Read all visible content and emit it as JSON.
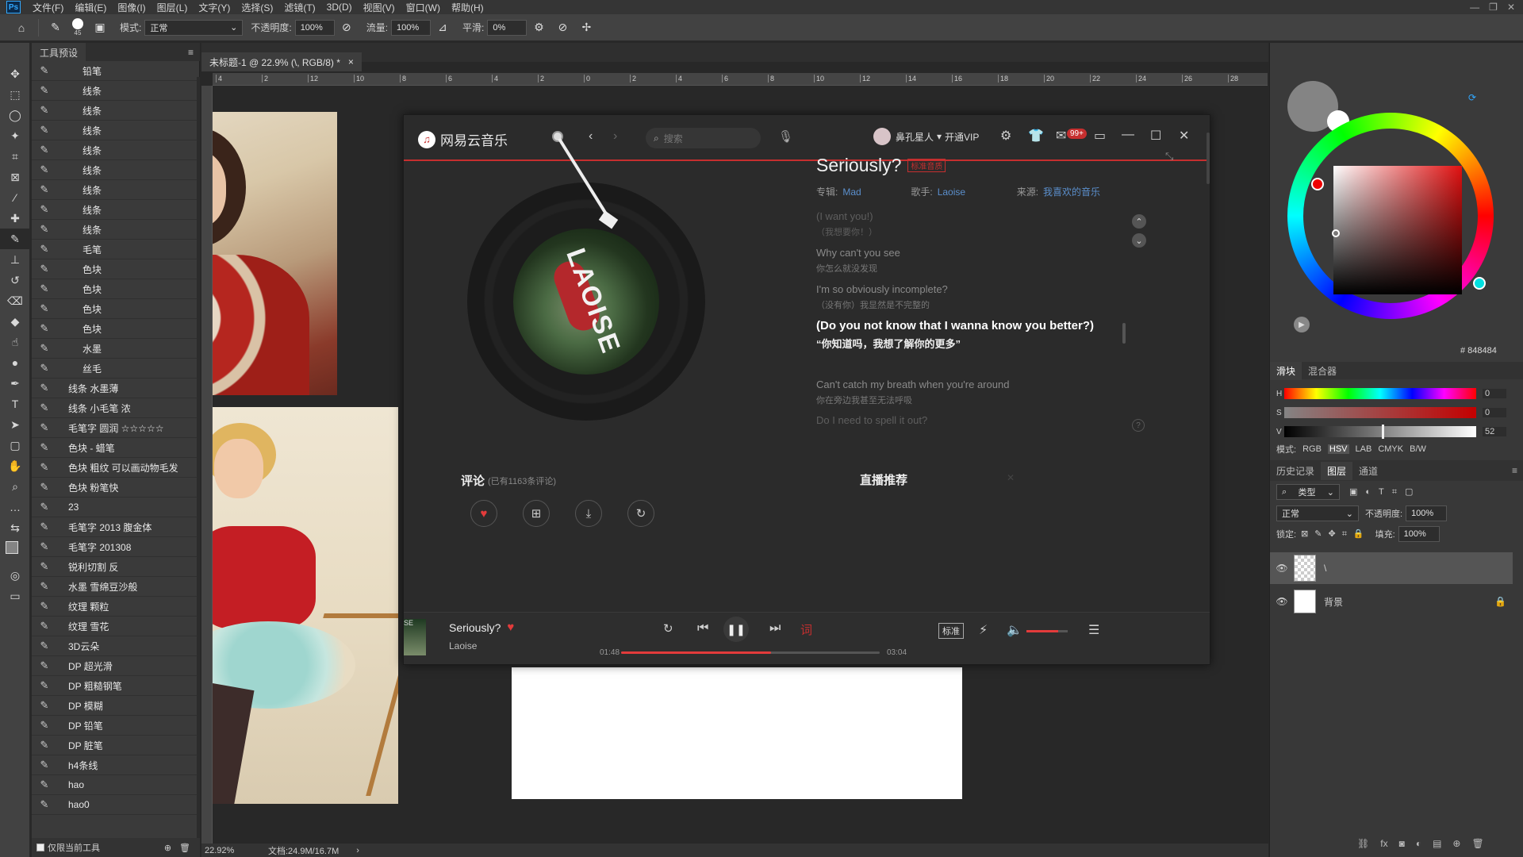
{
  "menubar": {
    "logo": "Ps",
    "items": [
      "文件(F)",
      "编辑(E)",
      "图像(I)",
      "图层(L)",
      "文字(Y)",
      "选择(S)",
      "滤镜(T)",
      "3D(D)",
      "视图(V)",
      "窗口(W)",
      "帮助(H)"
    ]
  },
  "options": {
    "brush_size": "45",
    "mode_label": "模式:",
    "mode_value": "正常",
    "opacity_label": "不透明度:",
    "opacity_value": "100%",
    "flow_label": "流量:",
    "flow_value": "100%",
    "smooth_label": "平滑:",
    "smooth_value": "0%"
  },
  "presets": {
    "tab": "工具预设",
    "items": [
      "铅笔",
      "线条",
      "线条",
      "线条",
      "线条",
      "线条",
      "线条",
      "线条",
      "线条",
      "毛笔",
      "色块",
      "色块",
      "色块",
      "色块",
      "水墨",
      "丝毛",
      "线条 水墨薄",
      "线条 小毛笔 浓",
      "毛笔字 圆润 ☆☆☆☆☆",
      "色块 - 蜡笔",
      "色块 粗纹 可以画动物毛发",
      "色块 粉笔快",
      "23",
      "毛笔字 2013 腹金体",
      "毛笔字 201308",
      "锐利切割 反",
      "水墨 雪绵豆沙般",
      "纹理 颗粒",
      "纹理 雪花",
      "3D云朵",
      "DP 超光滑",
      "DP 粗糙钢笔",
      "DP 模糊",
      "DP 铅笔",
      "DP 脏笔",
      "h4条线",
      "hao",
      "hao0"
    ],
    "footer": "仅限当前工具"
  },
  "document": {
    "tab_title": "未标题-1 @ 22.9% (\\, RGB/8) *",
    "zoom": "22.92%",
    "doc_size": "文档:24.9M/16.7M",
    "ruler_marks": [
      "4",
      "2",
      "12",
      "10",
      "8",
      "6",
      "4",
      "2",
      "0",
      "2",
      "4",
      "6",
      "8",
      "10",
      "12",
      "14",
      "16",
      "18",
      "20",
      "22",
      "24",
      "26",
      "28"
    ]
  },
  "music": {
    "app_name": "网易云音乐",
    "search_placeholder": "搜索",
    "user_name": "鼻孔星人",
    "vip": "开通VIP",
    "badge": "99+",
    "song_title": "Seriously?",
    "quality_tag": "标准音质",
    "album_label": "专辑:",
    "album": "Mad",
    "artist_label": "歌手:",
    "artist": "Laoise",
    "source_label": "来源:",
    "source": "我喜欢的音乐",
    "disc_text": "LAOISE",
    "lyrics": [
      {
        "en": "(I want you!)",
        "zh": "（我想要你！）",
        "active": false,
        "faded": true
      },
      {
        "en": "Why can't you see",
        "zh": "你怎么就没发现",
        "active": false,
        "faded": false
      },
      {
        "en": "I'm so obviously incomplete?",
        "zh": "（没有你）我显然是不完整的",
        "active": false,
        "faded": false
      },
      {
        "en": "(Do you not know that I wanna know you better?)",
        "zh": "“你知道吗，我想了解你的更多”",
        "active": true,
        "faded": false
      },
      {
        "en": "Can't catch my breath when you're around",
        "zh": "你在旁边我甚至无法呼吸",
        "active": false,
        "faded": false
      },
      {
        "en": "Do I need to spell it out?",
        "zh": "",
        "active": false,
        "faded": true
      }
    ],
    "comments_label": "评论",
    "comments_count": "(已有1163条评论)",
    "live_label": "直播推荐",
    "player": {
      "title": "Seriously?",
      "artist": "Laoise",
      "current": "01:48",
      "total": "03:04",
      "progress": 0.58,
      "quality": "标准",
      "cover_text": "SE"
    }
  },
  "color_panel": {
    "hex": "# 848484",
    "tabs": [
      "滑块",
      "混合器"
    ],
    "slider_values": [
      "0",
      "0",
      "52"
    ],
    "slider_labels": [
      "H",
      "S",
      "V"
    ],
    "modes_label": "模式:",
    "modes": [
      "RGB",
      "HSV",
      "LAB",
      "CMYK",
      "B/W"
    ]
  },
  "layers_panel": {
    "tabs": [
      "历史记录",
      "图层",
      "通道"
    ],
    "filter": "类型",
    "blend": "正常",
    "opacity_label": "不透明度:",
    "opacity": "100%",
    "lock_label": "锁定:",
    "fill_label": "填充:",
    "fill": "100%",
    "layers": [
      {
        "name": "\\",
        "selected": true
      },
      {
        "name": "背景",
        "selected": false
      }
    ]
  },
  "colors": {
    "accent_red": "#c62f2f",
    "link_blue": "#5b8fcc",
    "ps_bg": "#282828"
  }
}
